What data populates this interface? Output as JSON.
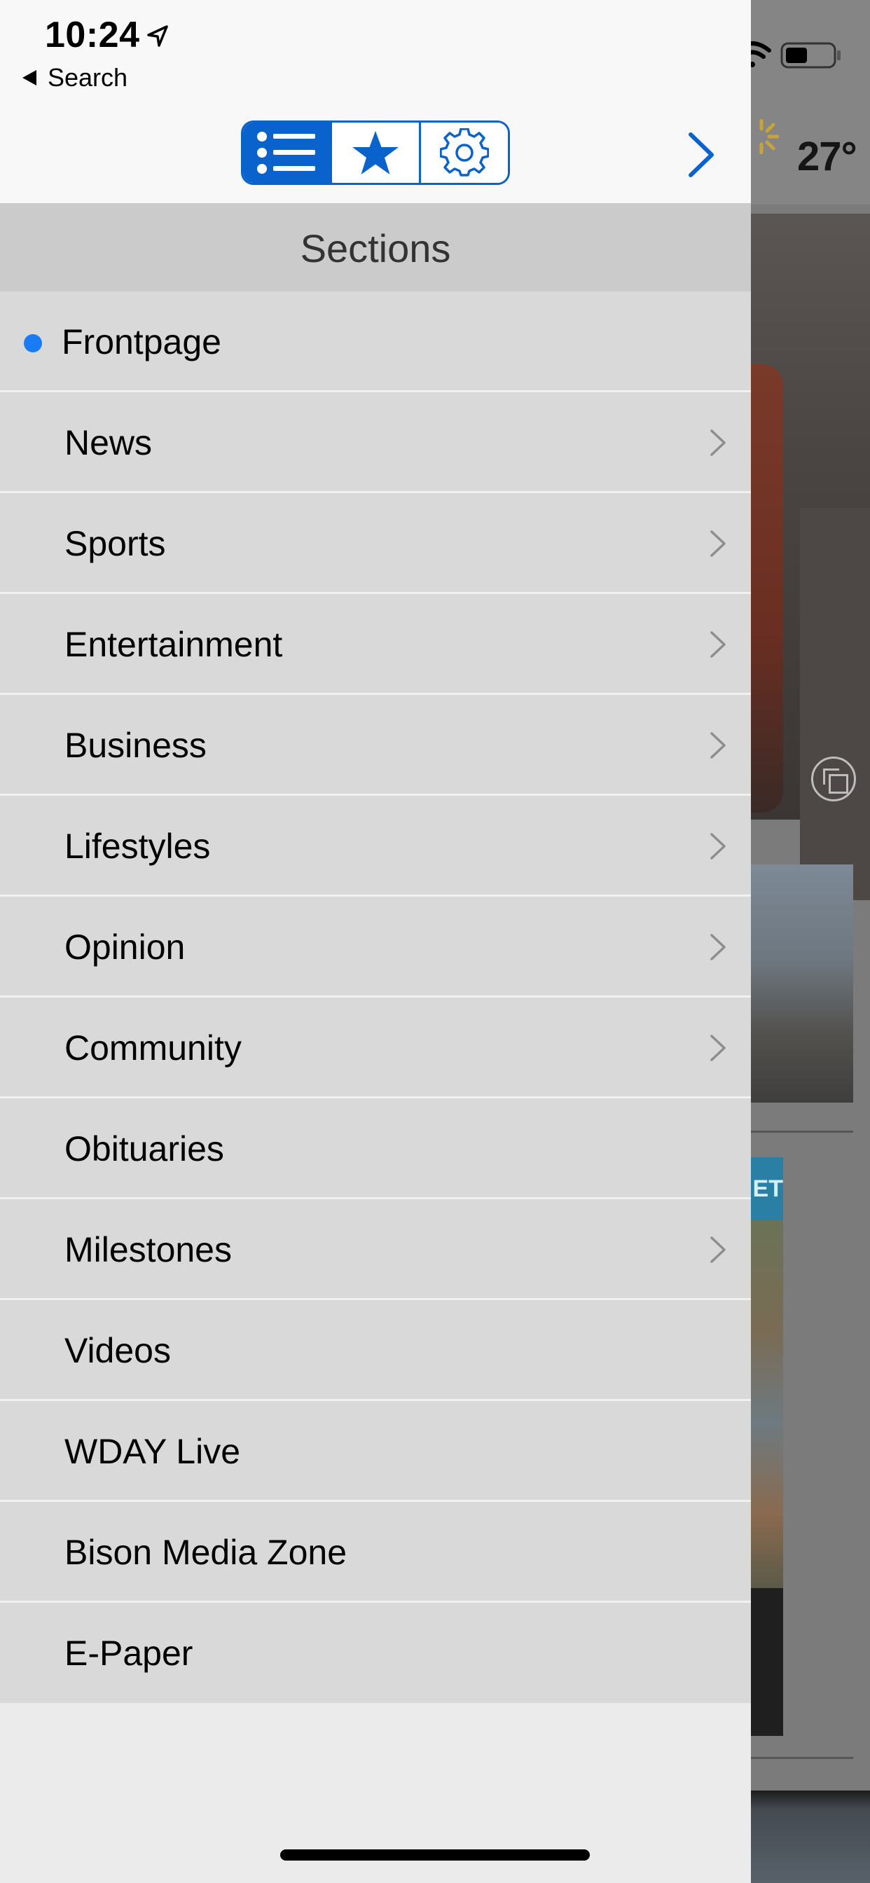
{
  "status_bar": {
    "time": "10:24",
    "back_label": "Search",
    "icons": [
      "location-arrow-icon",
      "cellular-signal-icon",
      "wifi-icon",
      "battery-icon"
    ]
  },
  "toolbar": {
    "segments": [
      {
        "icon": "list-icon",
        "active": true
      },
      {
        "icon": "star-icon",
        "active": false
      },
      {
        "icon": "gear-icon",
        "active": false
      }
    ],
    "next_icon": "chevron-right-icon",
    "accent": "#0a63cc"
  },
  "background_app": {
    "temperature": "27°",
    "weather_icon": "sun-icon"
  },
  "sections": {
    "title": "Sections",
    "items": [
      {
        "label": "Frontpage",
        "selected": true,
        "has_children": false
      },
      {
        "label": "News",
        "selected": false,
        "has_children": true
      },
      {
        "label": "Sports",
        "selected": false,
        "has_children": true
      },
      {
        "label": "Entertainment",
        "selected": false,
        "has_children": true
      },
      {
        "label": "Business",
        "selected": false,
        "has_children": true
      },
      {
        "label": "Lifestyles",
        "selected": false,
        "has_children": true
      },
      {
        "label": "Opinion",
        "selected": false,
        "has_children": true
      },
      {
        "label": "Community",
        "selected": false,
        "has_children": true
      },
      {
        "label": "Obituaries",
        "selected": false,
        "has_children": false
      },
      {
        "label": "Milestones",
        "selected": false,
        "has_children": true
      },
      {
        "label": "Videos",
        "selected": false,
        "has_children": false
      },
      {
        "label": "WDAY Live",
        "selected": false,
        "has_children": false
      },
      {
        "label": "Bison Media Zone",
        "selected": false,
        "has_children": false
      },
      {
        "label": "E-Paper",
        "selected": false,
        "has_children": false
      }
    ]
  },
  "colors": {
    "selected_dot": "#1a7cf5",
    "menu_bg": "#d9d9d9",
    "header_bg": "#cbcbcb"
  }
}
